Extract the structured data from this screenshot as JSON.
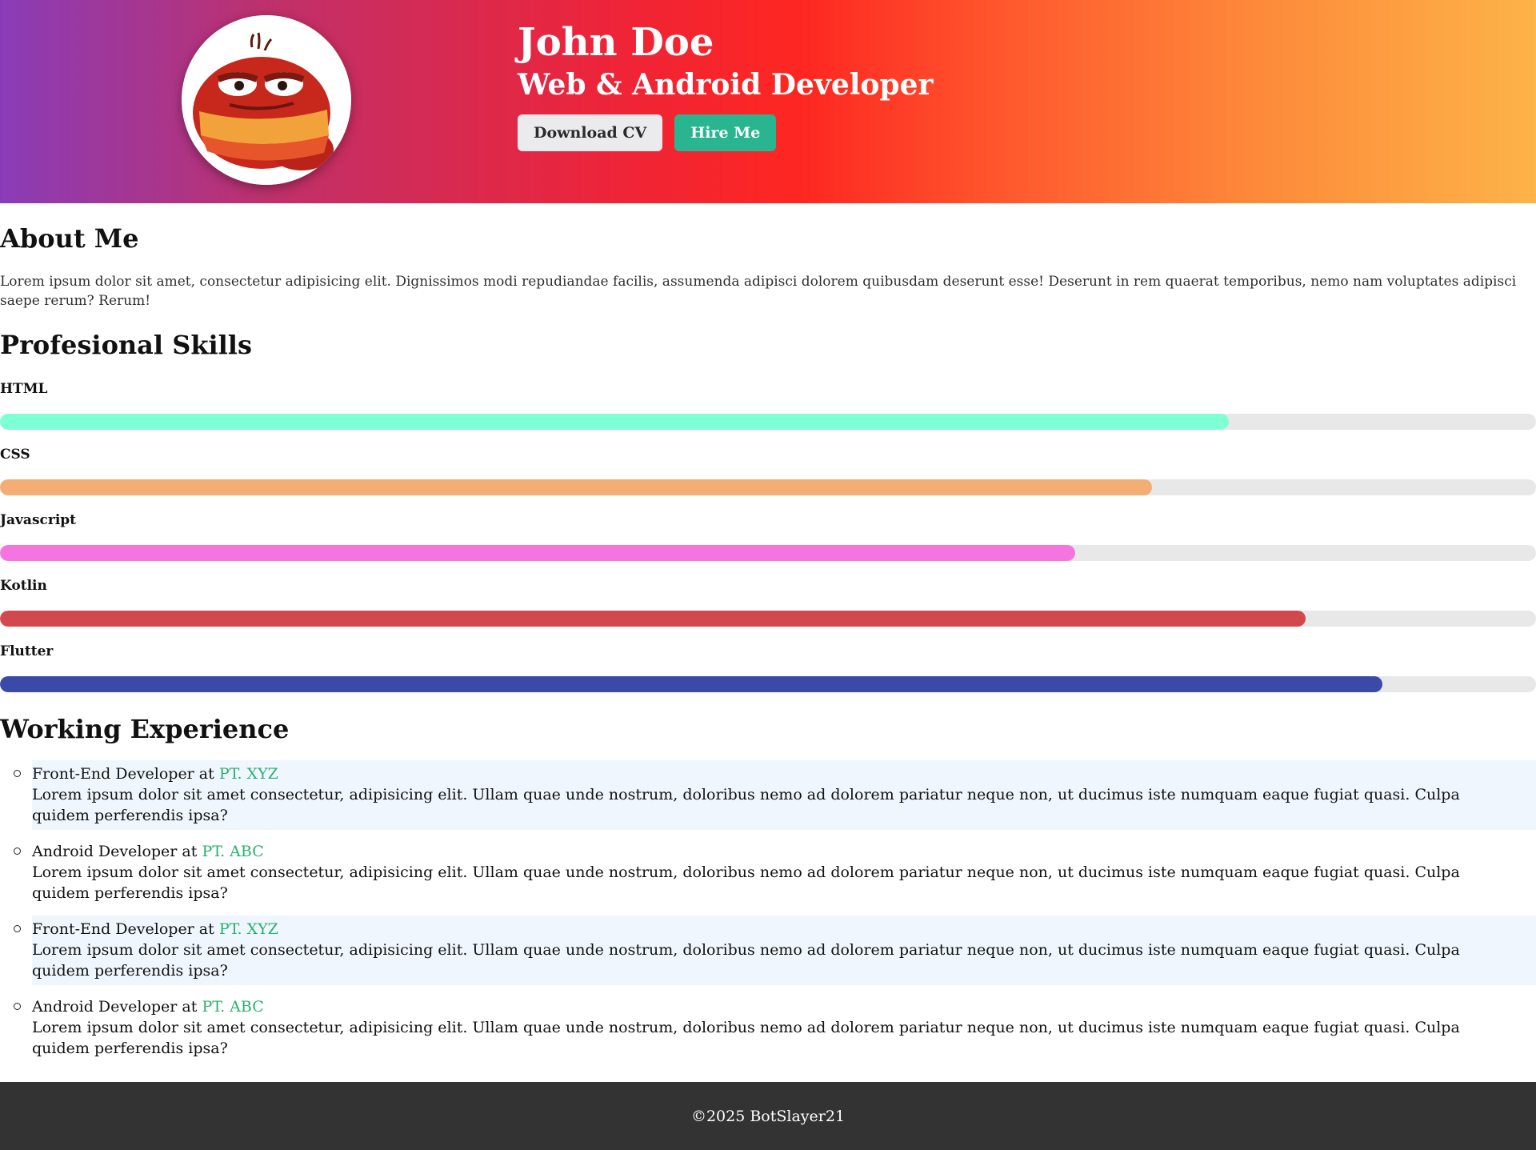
{
  "header": {
    "name": "John Doe",
    "role": "Web & Android Developer",
    "download_label": "Download CV",
    "hire_label": "Hire Me",
    "avatar_icon": "cartoon-character-avatar"
  },
  "about": {
    "title": "About Me",
    "text": "Lorem ipsum dolor sit amet, consectetur adipisicing elit. Dignissimos modi repudiandae facilis, assumenda adipisci dolorem quibusdam deserunt esse! Deserunt in rem quaerat temporibus, nemo nam voluptates adipisci saepe rerum? Rerum!"
  },
  "skills": {
    "title": "Profesional Skills",
    "items": [
      {
        "name": "HTML",
        "level": 0.8,
        "color": "#7fffd4"
      },
      {
        "name": "CSS",
        "level": 0.75,
        "color": "#f4ad72"
      },
      {
        "name": "Javascript",
        "level": 0.7,
        "color": "#f575e0"
      },
      {
        "name": "Kotlin",
        "level": 0.85,
        "color": "#d2494d"
      },
      {
        "name": "Flutter",
        "level": 0.9,
        "color": "#3b4aa8"
      }
    ]
  },
  "experience": {
    "title": "Working Experience",
    "items": [
      {
        "role": "Front-End Developer at ",
        "company": "PT. XYZ",
        "desc": "Lorem ipsum dolor sit amet consectetur, adipisicing elit. Ullam quae unde nostrum, doloribus nemo ad dolorem pariatur neque non, ut ducimus iste numquam eaque fugiat quasi. Culpa quidem perferendis ipsa?"
      },
      {
        "role": "Android Developer at ",
        "company": "PT. ABC",
        "desc": "Lorem ipsum dolor sit amet consectetur, adipisicing elit. Ullam quae unde nostrum, doloribus nemo ad dolorem pariatur neque non, ut ducimus iste numquam eaque fugiat quasi. Culpa quidem perferendis ipsa?"
      },
      {
        "role": "Front-End Developer at ",
        "company": "PT. XYZ",
        "desc": "Lorem ipsum dolor sit amet consectetur, adipisicing elit. Ullam quae unde nostrum, doloribus nemo ad dolorem pariatur neque non, ut ducimus iste numquam eaque fugiat quasi. Culpa quidem perferendis ipsa?"
      },
      {
        "role": "Android Developer at ",
        "company": "PT. ABC",
        "desc": "Lorem ipsum dolor sit amet consectetur, adipisicing elit. Ullam quae unde nostrum, doloribus nemo ad dolorem pariatur neque non, ut ducimus iste numquam eaque fugiat quasi. Culpa quidem perferendis ipsa?"
      }
    ]
  },
  "footer": {
    "text": "©2025 BotSlayer21"
  }
}
